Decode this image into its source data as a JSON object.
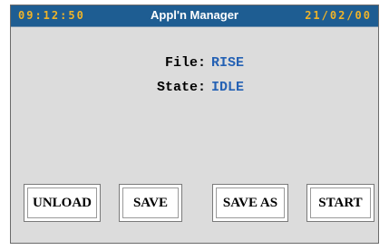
{
  "header": {
    "time": "09:12:50",
    "title": "Appl'n Manager",
    "date": "21/02/00"
  },
  "info": {
    "file_label": "File:",
    "file_value": "RISE",
    "state_label": "State:",
    "state_value": "IDLE"
  },
  "buttons": [
    {
      "label": "UNLOAD"
    },
    {
      "label": "SAVE"
    },
    {
      "label": "SAVE AS"
    },
    {
      "label": "START"
    }
  ],
  "colors": {
    "titlebar_bg": "#1e5d92",
    "header_text": "#f0b429",
    "title_text": "#ffffff",
    "value_text": "#2461b4",
    "label_text": "#000000",
    "screen_bg": "#dcdcdc"
  }
}
